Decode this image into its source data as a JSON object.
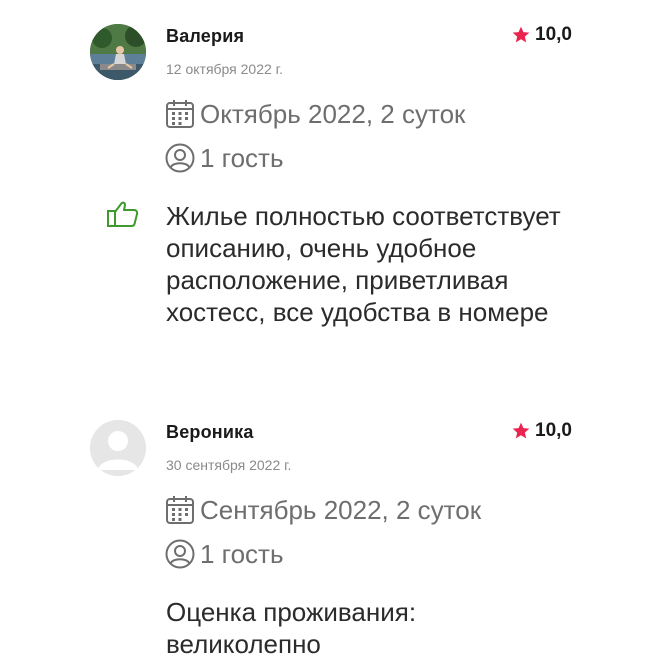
{
  "reviews": [
    {
      "author": "Валерия",
      "date": "12 октября 2022 г.",
      "rating": "10,0",
      "stay": "Октябрь 2022, 2 суток",
      "guests": "1 гость",
      "text": "Жилье полностью соответствует описанию, очень удобное расположение, приветливая хостесс, все удобства в номере",
      "avatar": "photo"
    },
    {
      "author": "Вероника",
      "date": "30 сентября 2022 г.",
      "rating": "10,0",
      "stay": "Сентябрь 2022, 2 суток",
      "guests": "1 гость",
      "text": "Оценка проживания: великолепно",
      "avatar": "default"
    }
  ],
  "colors": {
    "star": "#e8244f",
    "like": "#3f9a2e",
    "muted": "#6e6e6e"
  },
  "icons": [
    "star-icon",
    "calendar-icon",
    "user-icon",
    "thumbs-up-icon",
    "default-avatar-icon"
  ]
}
